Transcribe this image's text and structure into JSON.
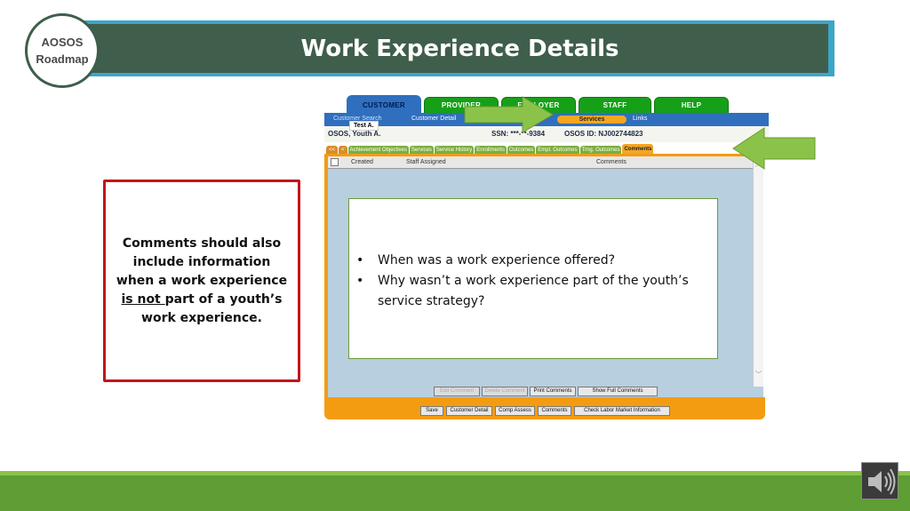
{
  "banner": {
    "title": "Work Experience Details"
  },
  "badge": {
    "line1": "AOSOS",
    "line2": "Roadmap"
  },
  "callout": {
    "part1": "Comments should also include information when a work experience ",
    "underlined": "is not ",
    "part2": "part of a youth’s work experience."
  },
  "app": {
    "tabs": {
      "customer": "CUSTOMER",
      "provider": "PROVIDER",
      "employer": "EMPLOYER",
      "staff": "STAFF",
      "help": "HELP"
    },
    "nav": {
      "customer_search": "Customer Search",
      "customer_detail": "Customer Detail",
      "services": "Services",
      "links": "Links"
    },
    "name_tag": "Test A.",
    "info": {
      "name": "OSOS, Youth A.",
      "ssn": "SSN: ***-**-9384",
      "osos_id": "OSOS ID: NJ002744823"
    },
    "subtabs": [
      "<<",
      "<",
      "Achievement Objectives",
      "Services",
      "Service History",
      "Enrollments",
      "Outcomes",
      "Empl. Outcomes",
      "Trng. Outcomes",
      "Comments"
    ],
    "grid_headers": {
      "created": "Created",
      "staff": "Staff Assigned",
      "comments": "Comments"
    },
    "buttons_row1": [
      "Edit Comment",
      "Delete Comment",
      "Print Comments",
      "Show Full Comments"
    ],
    "buttons_row2": [
      "Save",
      "Customer Detail",
      "Comp Assess",
      "Comments",
      "Check Labor Market Information"
    ]
  },
  "overlay": {
    "bullet1": "When was a work experience offered?",
    "bullet2": "Why wasn’t a work experience part of the youth’s service strategy?"
  },
  "colors": {
    "banner": "#3f5e4b",
    "banner_border": "#3aa6c8",
    "callout_border": "#c0161b",
    "app_tab_green": "#16a018",
    "app_orange": "#f39c12",
    "footer": "#5e9e34",
    "arrow": "#8bc34a"
  },
  "icons": {
    "speaker": "speaker-icon",
    "arrows": "green-arrow-icon"
  }
}
